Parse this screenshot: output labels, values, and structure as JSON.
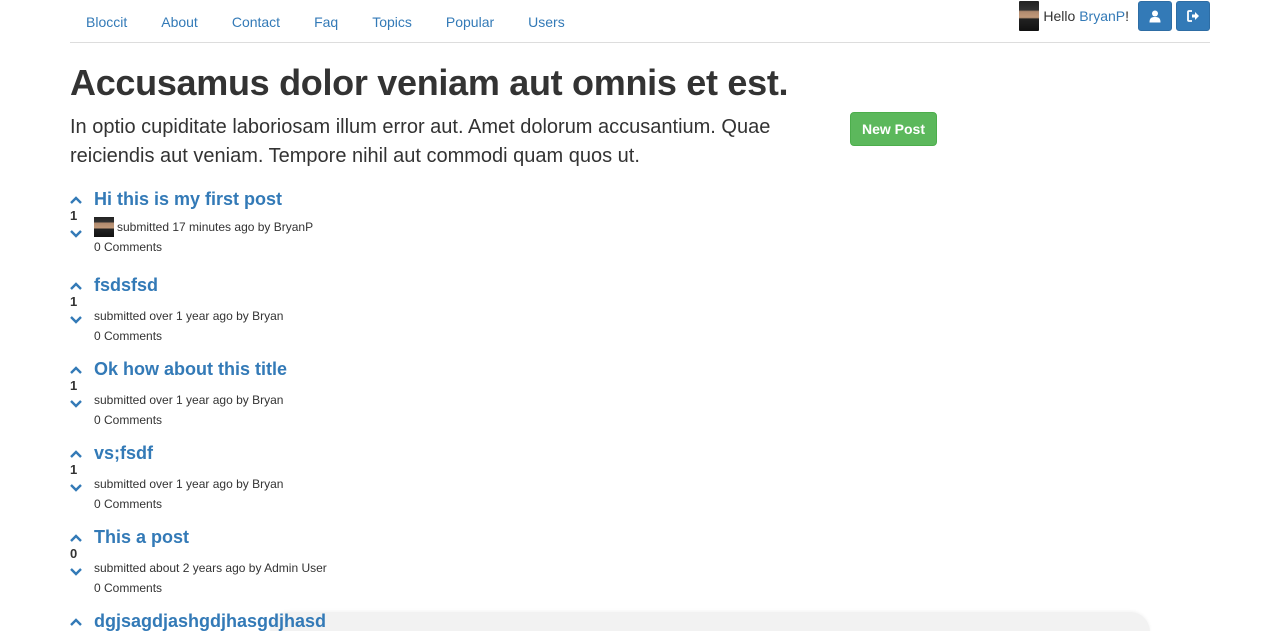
{
  "nav": {
    "links": [
      "Bloccit",
      "About",
      "Contact",
      "Faq",
      "Topics",
      "Popular",
      "Users"
    ],
    "hello_prefix": "Hello ",
    "username": "BryanP",
    "hello_suffix": "!",
    "profile_icon": "user-icon",
    "logout_icon": "sign-out-icon"
  },
  "header": {
    "title": "Accusamus dolor veniam aut omnis et est.",
    "lead": "In optio cupiditate laboriosam illum error aut. Amet dolorum accusantium. Quae reiciendis aut veniam. Tempore nihil aut commodi quam quos ut.",
    "new_post_label": "New Post"
  },
  "posts": [
    {
      "title": "Hi this is my first post",
      "votes": "1",
      "meta": "submitted 17 minutes ago by BryanP",
      "comments": "0 Comments"
    },
    {
      "title": "fsdsfsd",
      "votes": "1",
      "meta": "submitted over 1 year ago by Bryan",
      "comments": "0 Comments"
    },
    {
      "title": "Ok how about this title",
      "votes": "1",
      "meta": "submitted over 1 year ago by Bryan",
      "comments": "0 Comments"
    },
    {
      "title": "vs;fsdf",
      "votes": "1",
      "meta": "submitted over 1 year ago by Bryan",
      "comments": "0 Comments"
    },
    {
      "title": "This a post",
      "votes": "0",
      "meta": "submitted about 2 years ago by Admin User",
      "comments": "0 Comments"
    },
    {
      "title": "dgjsagdjashgdjhasgdjhasd",
      "votes": "",
      "meta": "",
      "comments": ""
    }
  ],
  "colors": {
    "link": "#337ab7",
    "success": "#5cb85c",
    "text": "#333333"
  }
}
